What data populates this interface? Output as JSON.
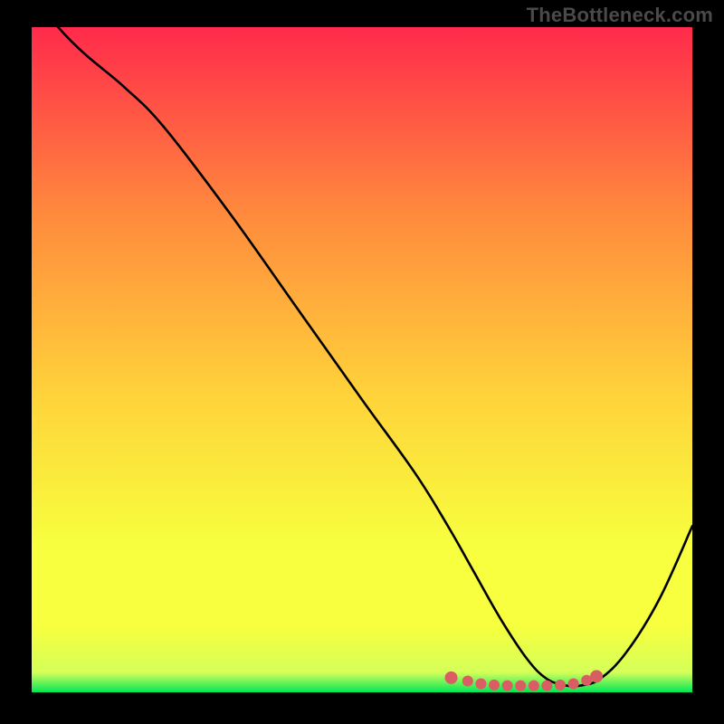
{
  "watermark": "TheBottleneck.com",
  "colors": {
    "black": "#000000",
    "curve": "#000000",
    "marker": "#da5d63",
    "grad_top": "#ff2a4b",
    "grad_mid1": "#ff8a3d",
    "grad_mid2": "#ffd23a",
    "grad_low1": "#f7ff3e",
    "grad_low2": "#d5ff59",
    "grad_bottom": "#00e756"
  },
  "chart_data": {
    "type": "line",
    "title": "",
    "xlabel": "",
    "ylabel": "",
    "xlim": [
      0,
      100
    ],
    "ylim": [
      0,
      100
    ],
    "x": [
      0,
      4,
      8,
      14,
      20,
      30,
      40,
      50,
      58,
      63,
      67,
      71,
      75,
      78,
      81,
      83,
      86,
      90,
      95,
      100
    ],
    "y": [
      105,
      100,
      96,
      91,
      85,
      72,
      58,
      44,
      33,
      25,
      18,
      11,
      5,
      2,
      1,
      1,
      2,
      6,
      14,
      25
    ],
    "markers": {
      "x": [
        63.5,
        66,
        68,
        70,
        72,
        74,
        76,
        78,
        80,
        82,
        84,
        85.5
      ],
      "y": [
        2.2,
        1.7,
        1.3,
        1.1,
        1.0,
        1.0,
        1.0,
        1.0,
        1.1,
        1.3,
        1.8,
        2.4
      ]
    }
  }
}
